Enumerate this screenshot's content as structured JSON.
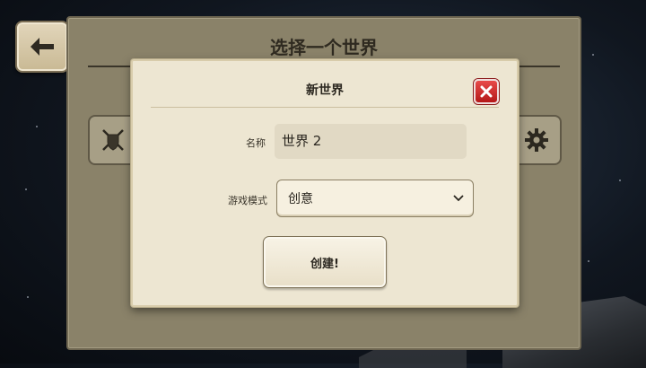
{
  "background": {
    "title": "选择一个世界",
    "left_icon": "sword-shield-icon",
    "right_icon": "gear-icon"
  },
  "back_button": {
    "icon": "back-arrow-icon"
  },
  "dialog": {
    "title": "新世界",
    "close_icon": "close-icon",
    "name_label": "名称",
    "name_value": "世界 2",
    "mode_label": "游戏模式",
    "mode_value": "创意",
    "create_label": "创建!"
  },
  "colors": {
    "panel": "#ede6d2",
    "close_red": "#d42a2a",
    "field_bg": "#e1d9c4"
  }
}
